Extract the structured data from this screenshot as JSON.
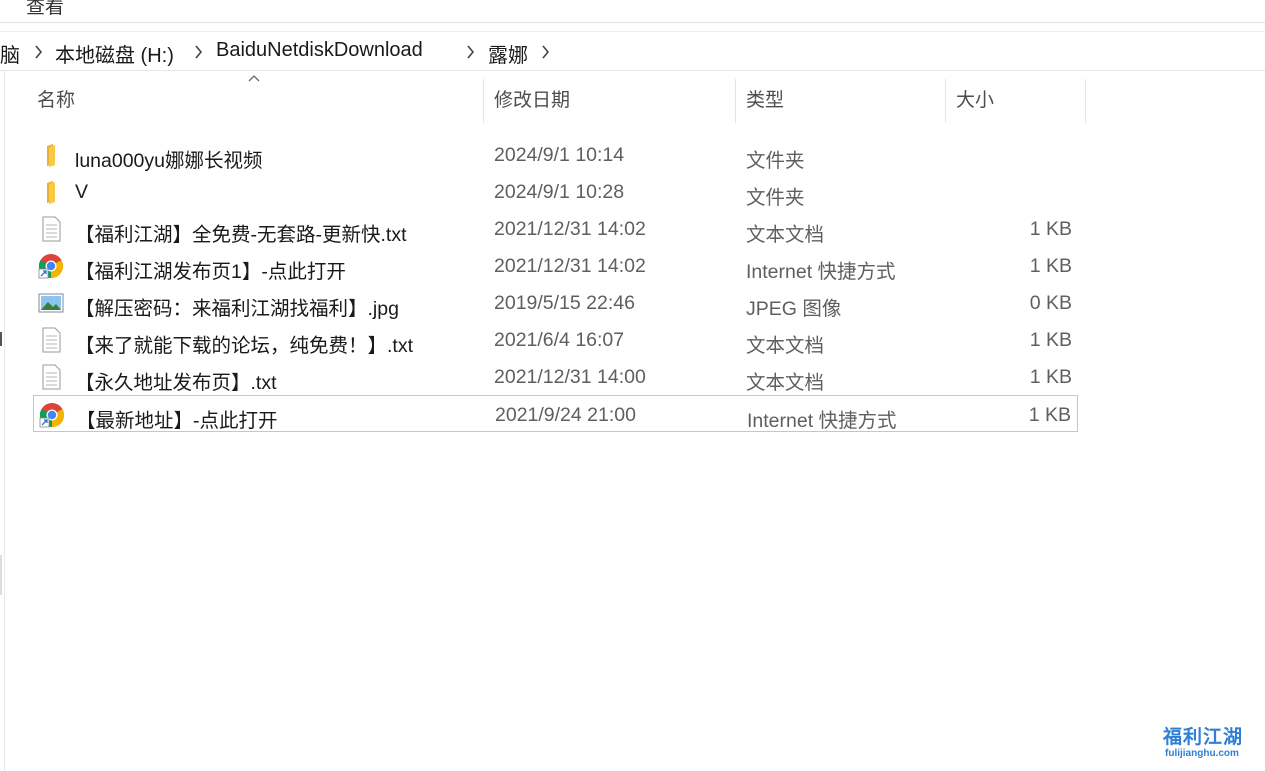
{
  "ribbon": {
    "view_tab": "查看"
  },
  "breadcrumb": {
    "items": [
      "脑",
      "本地磁盘 (H:)",
      "BaiduNetdiskDownload",
      "露娜"
    ]
  },
  "columns": {
    "name": "名称",
    "date": "修改日期",
    "type": "类型",
    "size": "大小"
  },
  "files": [
    {
      "name": "luna000yu娜娜长视频",
      "date": "2024/9/1 10:14",
      "type": "文件夹",
      "size": "",
      "icon": "folder-icon"
    },
    {
      "name": "V",
      "date": "2024/9/1 10:28",
      "type": "文件夹",
      "size": "",
      "icon": "folder-icon"
    },
    {
      "name": "【福利江湖】全免费-无套路-更新快.txt",
      "date": "2021/12/31 14:02",
      "type": "文本文档",
      "size": "1 KB",
      "icon": "text-file-icon"
    },
    {
      "name": "【福利江湖发布页1】-点此打开",
      "date": "2021/12/31 14:02",
      "type": "Internet 快捷方式",
      "size": "1 KB",
      "icon": "chrome-shortcut-icon"
    },
    {
      "name": "【解压密码：来福利江湖找福利】.jpg",
      "date": "2019/5/15 22:46",
      "type": "JPEG 图像",
      "size": "0 KB",
      "icon": "image-file-icon"
    },
    {
      "name": "【来了就能下载的论坛，纯免费！】.txt",
      "date": "2021/6/4 16:07",
      "type": "文本文档",
      "size": "1 KB",
      "icon": "text-file-icon"
    },
    {
      "name": "【永久地址发布页】.txt",
      "date": "2021/12/31 14:00",
      "type": "文本文档",
      "size": "1 KB",
      "icon": "text-file-icon"
    },
    {
      "name": "【最新地址】-点此打开",
      "date": "2021/9/24 21:00",
      "type": "Internet 快捷方式",
      "size": "1 KB",
      "icon": "chrome-shortcut-icon"
    }
  ],
  "watermark": {
    "title": "福利江湖",
    "site": "fulijianghu.com"
  },
  "colors": {
    "selection_border": "#99d1ff",
    "folder": "#f8c846",
    "watermark": "#2f7fd6"
  }
}
